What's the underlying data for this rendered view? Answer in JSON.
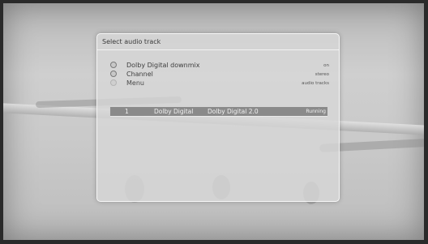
{
  "dialog": {
    "title": "Select audio track",
    "options": [
      {
        "label": "Dolby Digital downmix",
        "value": "on"
      },
      {
        "label": "Channel",
        "value": "stereo"
      },
      {
        "label": "Menu",
        "value": "audio tracks"
      }
    ],
    "tracks": [
      {
        "number": "1",
        "name": "Dolby Digital",
        "format": "Dolby Digital 2.0",
        "status": "Running"
      }
    ]
  },
  "colors": {
    "highlight_row": "#8a8a8a",
    "dialog_bg": "#d7d7d7"
  }
}
